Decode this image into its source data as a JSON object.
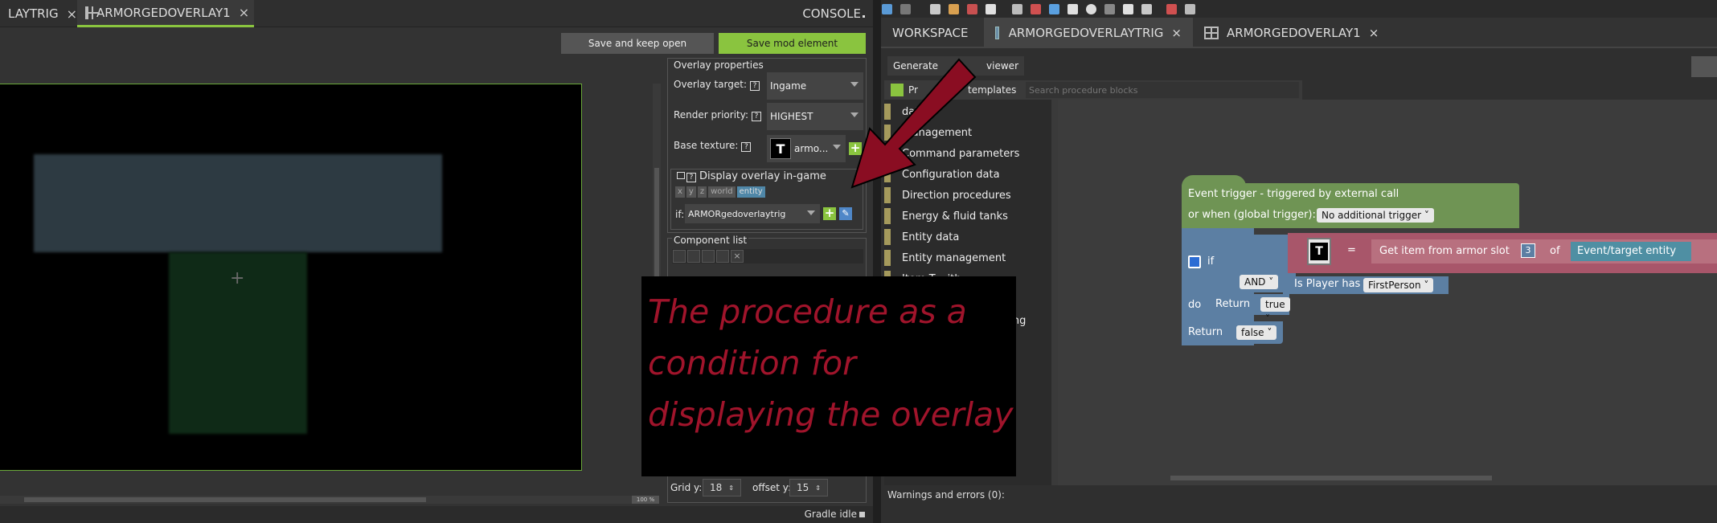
{
  "left": {
    "tabs": [
      {
        "label": "LAYTRIG",
        "close": "×"
      },
      {
        "label": "ARMORGEDOVERLAY1",
        "close": "×"
      }
    ],
    "console_label": "CONSOLE",
    "save_open_label": "Save and keep open",
    "save_mod_label": "Save mod element",
    "zoom_label": "100 %",
    "gradle_status": "Gradle idle",
    "props": {
      "group_title": "Overlay properties",
      "overlay_target_label": "Overlay target:",
      "overlay_target_value": "Ingame",
      "render_priority_label": "Render priority:",
      "render_priority_value": "HIGHEST",
      "base_texture_label": "Base texture:",
      "base_texture_value": "armo...",
      "display_label": "Display overlay in-game",
      "chips": [
        "x",
        "y",
        "z",
        "world",
        "entity"
      ],
      "if_label": "if:",
      "if_value": "ARMORgedoverlaytrig",
      "component_list_label": "Component list",
      "grid_y_label": "Grid y:",
      "grid_y_value": "18",
      "offset_y_label": "offset y:",
      "offset_y_value": "15",
      "help_glyph": "?"
    }
  },
  "right": {
    "tabs": [
      {
        "label": "WORKSPACE"
      },
      {
        "label": "ARMORGEDOVERLAYTRIG",
        "close": "×"
      },
      {
        "label": "ARMORGEDOVERLAY1",
        "close": "×"
      }
    ],
    "generate_label": "Generate",
    "viewer_label": "viewer",
    "pr_label": "Pr",
    "templates_label": "templates",
    "search_placeholder": "Search procedure blocks",
    "categories": [
      {
        "label": "data",
        "color": "#a59a5c"
      },
      {
        "label": "management",
        "color": "#a59a5c"
      },
      {
        "label": "Command parameters",
        "color": "#a59a5c"
      },
      {
        "label": "Configuration data",
        "color": "#a59a5c"
      },
      {
        "label": "Direction procedures",
        "color": "#a59a5c"
      },
      {
        "label": "Energy & fluid tanks",
        "color": "#a59a5c"
      },
      {
        "label": "Entity data",
        "color": "#a59a5c"
      },
      {
        "label": "Entity management",
        "color": "#a59a5c"
      },
      {
        "label": "Item T... ith",
        "color": "#a59a5c"
      },
      {
        "label": "ckLang",
        "color": "#a59a5c"
      }
    ],
    "blocks": {
      "event_title": "Event trigger - triggered by external call",
      "or_when": "or when (global trigger):",
      "no_trigger": "No additional trigger",
      "if_kw": "if",
      "do_kw": "do",
      "and_kw": "AND",
      "eq": "=",
      "get_item": "Get item from armor slot",
      "slot_value": "3",
      "of_kw": "of",
      "entity": "Event/target entity",
      "is_player_has": "Is Player has",
      "first_person": "FirstPerson",
      "return_kw": "Return",
      "true_val": "true",
      "false_val": "false"
    },
    "warnings": "Warnings and errors (0):"
  },
  "annotation": {
    "lines": [
      "The procedure as a",
      "condition for",
      "displaying the overlay"
    ]
  },
  "colors": {
    "accent_green": "#8ac43f",
    "event_block": "#6f9454",
    "logic_block": "#5c7fa3",
    "entity_block": "#a8566a",
    "entity_pill": "#4f8fa3",
    "annotation_text": "#a0142b"
  }
}
